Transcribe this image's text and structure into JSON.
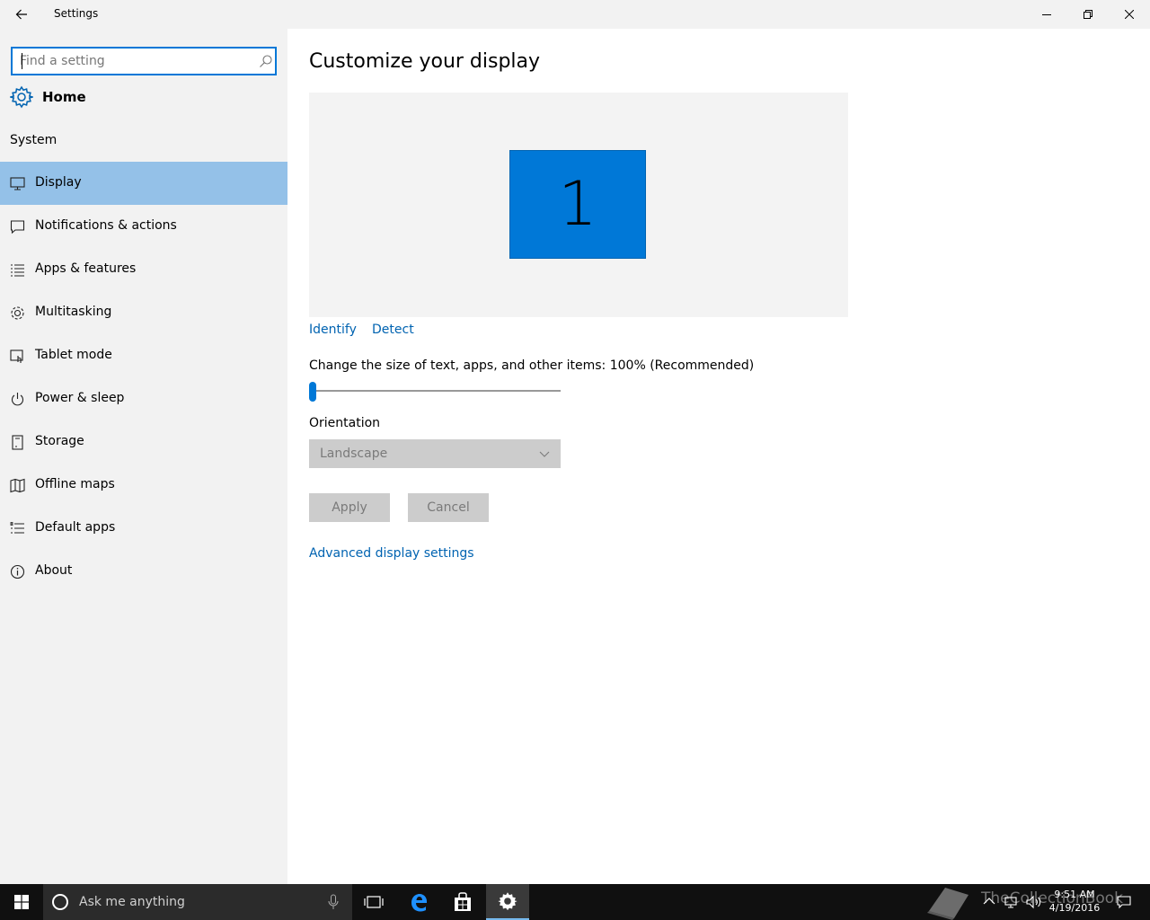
{
  "window": {
    "title": "Settings",
    "controls": {
      "minimize": "minimize",
      "maximize": "restore",
      "close": "close"
    }
  },
  "sidebar": {
    "search": {
      "placeholder": "Find a setting",
      "value": ""
    },
    "home_label": "Home",
    "section_label": "System",
    "items": [
      {
        "label": "Display",
        "icon": "monitor-icon",
        "active": true
      },
      {
        "label": "Notifications & actions",
        "icon": "notification-icon",
        "active": false
      },
      {
        "label": "Apps & features",
        "icon": "list-icon",
        "active": false
      },
      {
        "label": "Multitasking",
        "icon": "multitasking-icon",
        "active": false
      },
      {
        "label": "Tablet mode",
        "icon": "tablet-mode-icon",
        "active": false
      },
      {
        "label": "Power & sleep",
        "icon": "power-icon",
        "active": false
      },
      {
        "label": "Storage",
        "icon": "storage-icon",
        "active": false
      },
      {
        "label": "Offline maps",
        "icon": "map-icon",
        "active": false
      },
      {
        "label": "Default apps",
        "icon": "default-apps-icon",
        "active": false
      },
      {
        "label": "About",
        "icon": "info-icon",
        "active": false
      }
    ]
  },
  "main": {
    "title": "Customize your display",
    "monitor_number": "1",
    "identify_link": "Identify",
    "detect_link": "Detect",
    "scale_label": "Change the size of text, apps, and other items: 100% (Recommended)",
    "scale_slider_fraction": 0.0,
    "orientation_label": "Orientation",
    "orientation_value": "Landscape",
    "apply_label": "Apply",
    "cancel_label": "Cancel",
    "advanced_link": "Advanced display settings"
  },
  "taskbar": {
    "search_placeholder": "Ask me anything",
    "time": "9:51 AM",
    "date": "4/19/2016",
    "watermark": "TheCollectionBook"
  },
  "colors": {
    "accent": "#0078d7",
    "link": "#0063b1",
    "selected": "#94c1e8",
    "taskbar": "#101010"
  }
}
